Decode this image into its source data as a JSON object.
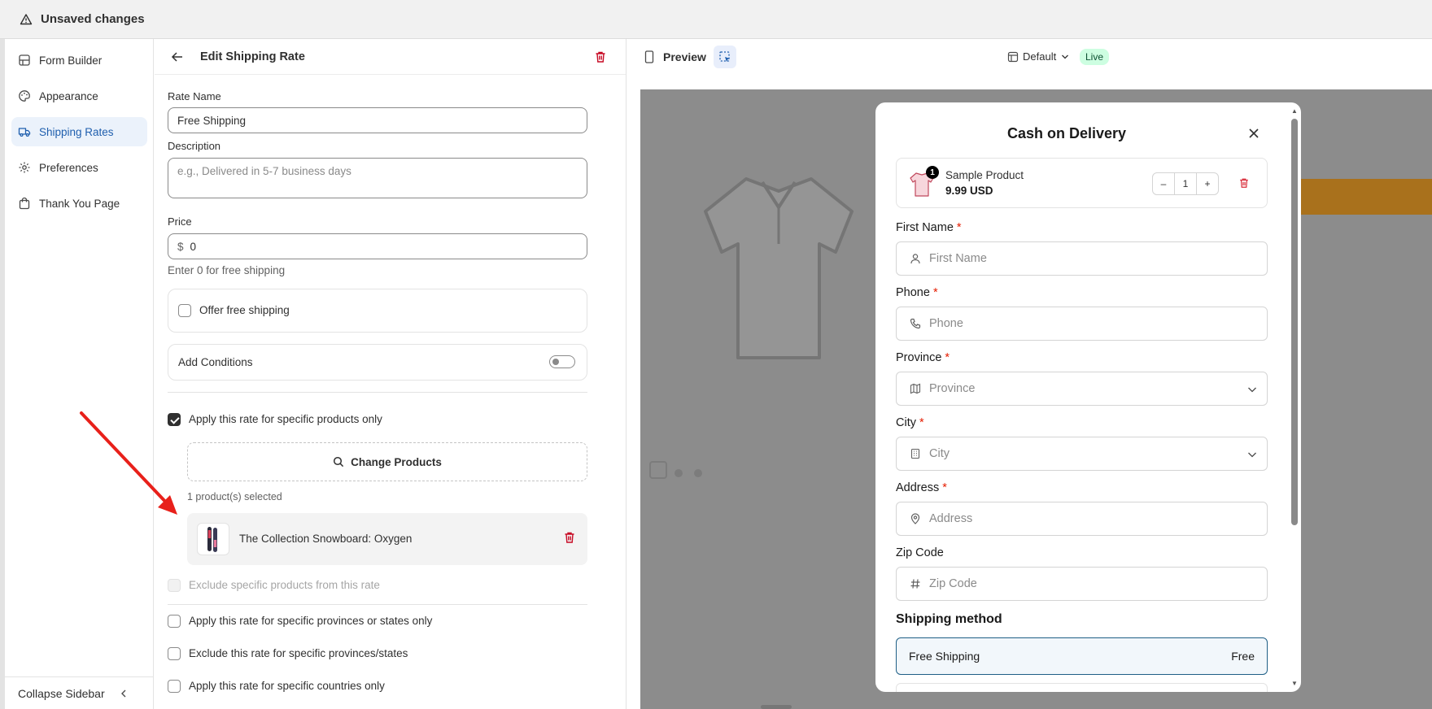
{
  "topbar": {
    "title": "Unsaved changes",
    "icon": "warning-icon"
  },
  "sidebar": {
    "items": [
      {
        "label": "Form Builder",
        "icon": "form-builder-icon",
        "active": false
      },
      {
        "label": "Appearance",
        "icon": "palette-icon",
        "active": false
      },
      {
        "label": "Shipping Rates",
        "icon": "truck-icon",
        "active": true
      },
      {
        "label": "Preferences",
        "icon": "gear-icon",
        "active": false
      },
      {
        "label": "Thank You Page",
        "icon": "shopping-bag-icon",
        "active": false
      }
    ],
    "collapse_label": "Collapse Sidebar"
  },
  "editor": {
    "title": "Edit Shipping Rate",
    "rate_name_label": "Rate Name",
    "rate_name_value": "Free Shipping",
    "description_label": "Description",
    "description_placeholder": "e.g., Delivered in 5-7 business days",
    "price_label": "Price",
    "price_currency": "$",
    "price_value": "0",
    "price_help": "Enter 0 for free shipping",
    "offer_free_shipping_label": "Offer free shipping",
    "offer_free_shipping_checked": false,
    "add_conditions_label": "Add Conditions",
    "add_conditions_on": false,
    "specific_products_label": "Apply this rate for specific products only",
    "specific_products_checked": true,
    "change_products_label": "Change Products",
    "selected_count": "1 product(s) selected",
    "selected_products": [
      {
        "name": "The Collection Snowboard: Oxygen"
      }
    ],
    "exclude_products_label": "Exclude specific products from this rate",
    "provinces_label": "Apply this rate for specific provinces or states only",
    "exclude_provinces_label": "Exclude this rate for specific provinces/states",
    "countries_label": "Apply this rate for specific countries only"
  },
  "preview": {
    "title": "Preview",
    "template": "Default",
    "status": "Live",
    "modal": {
      "title": "Cash on Delivery",
      "product": {
        "name": "Sample Product",
        "price": "9.99 USD",
        "quantity": "1",
        "badge": "1"
      },
      "fields": [
        {
          "label": "First Name",
          "placeholder": "First Name",
          "icon": "user-icon",
          "required": true,
          "select": false
        },
        {
          "label": "Phone",
          "placeholder": "Phone",
          "icon": "phone-icon",
          "required": true,
          "select": false
        },
        {
          "label": "Province",
          "placeholder": "Province",
          "icon": "map-icon",
          "required": true,
          "select": true
        },
        {
          "label": "City",
          "placeholder": "City",
          "icon": "building-icon",
          "required": true,
          "select": true
        },
        {
          "label": "Address",
          "placeholder": "Address",
          "icon": "map-pin-icon",
          "required": true,
          "select": false
        },
        {
          "label": "Zip Code",
          "placeholder": "Zip Code",
          "icon": "hash-icon",
          "required": false,
          "select": false
        }
      ],
      "required_mark": "*",
      "shipping_heading": "Shipping method",
      "shipping_option": {
        "name": "Free Shipping",
        "price": "Free"
      }
    }
  },
  "colors": {
    "accent": "#1f5fae",
    "danger": "#c70a24",
    "live_bg": "#cdfee1",
    "arrow": "#e8201a"
  }
}
